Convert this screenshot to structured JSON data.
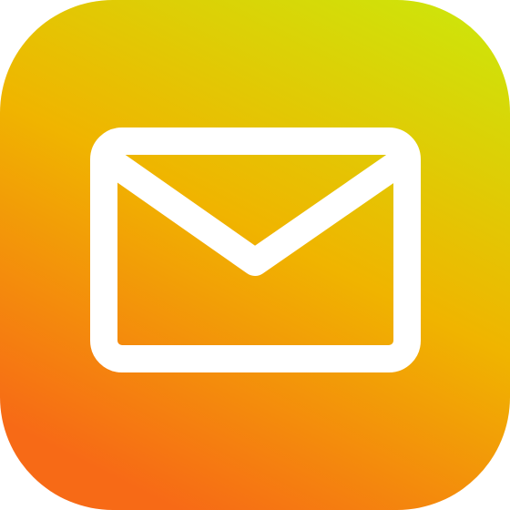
{
  "app_icon": {
    "name": "mail-app-icon",
    "icon": "envelope-icon",
    "colors": {
      "gradient_top_right": "#cfe30a",
      "gradient_middle": "#f0b400",
      "gradient_bottom": "#f76a16",
      "glyph": "#ffffff"
    }
  }
}
